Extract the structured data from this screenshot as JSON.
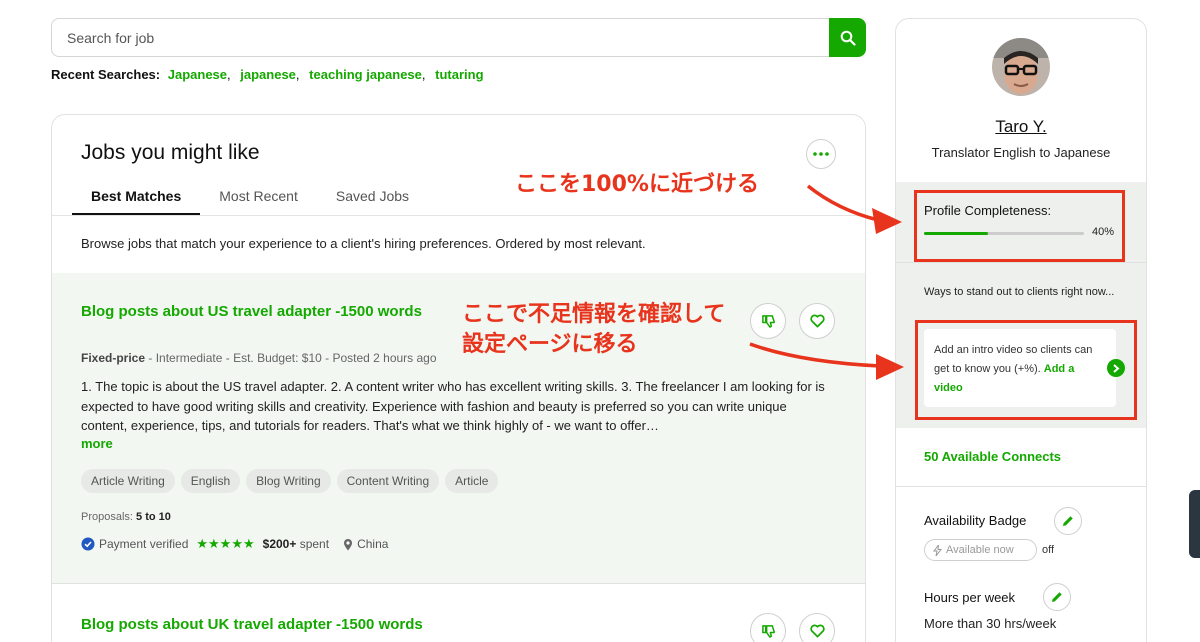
{
  "search": {
    "placeholder": "Search for job"
  },
  "recent": {
    "label": "Recent Searches:",
    "items": [
      "Japanese",
      "japanese",
      "teaching japanese",
      "tutaring"
    ]
  },
  "jobs": {
    "title": "Jobs you might like",
    "tabs": [
      "Best Matches",
      "Most Recent",
      "Saved Jobs"
    ],
    "active_tab": 0,
    "browse_text": "Browse jobs that match your experience to a client's hiring preferences. Ordered by most relevant.",
    "job1": {
      "title": "Blog posts about US travel adapter -1500 words",
      "type": "Fixed-price",
      "meta_rest": " - Intermediate - Est. Budget: $10 - Posted 2 hours ago",
      "description": "1. The topic is about the US travel adapter. 2. A content writer who has excellent writing skills. 3. The freelancer I am looking for is expected to have good writing skills and creativity. Experience with fashion and beauty is preferred so you can write unique content, experience, tips, and tutorials for readers. That's what we think highly of - we want to offer…",
      "more": "more",
      "tags": [
        "Article Writing",
        "English",
        "Blog Writing",
        "Content Writing",
        "Article"
      ],
      "proposals_label": "Proposals:",
      "proposals_value": "5 to 10",
      "payment": "Payment verified",
      "rating": 5,
      "stars": "★★★★★",
      "spent_value": "$200+",
      "spent_label": "spent",
      "country": "China"
    },
    "job2": {
      "title": "Blog posts about UK travel adapter -1500 words"
    }
  },
  "profile": {
    "name": "Taro Y.",
    "title": "Translator English to Japanese",
    "completeness_label": "Profile Completeness:",
    "completeness_pct": 40,
    "completeness_text": "40%",
    "ways_text": "Ways to stand out to clients right now...",
    "intro_text": "Add an intro video so clients can get to know you (+%). ",
    "intro_link": "Add a video",
    "connects": "50 Available Connects",
    "availability_label": "Availability Badge",
    "available_now": "Available now",
    "available_status": "off",
    "hours_label": "Hours per week",
    "hours_value": "More than 30 hrs/week"
  },
  "annotations": {
    "a1": "ここを100%に近づける",
    "a2_line1": "ここで不足情報を確認して",
    "a2_line2": "設定ページに移る"
  },
  "colors": {
    "brand": "#14a800",
    "annotation": "#e8341c"
  }
}
